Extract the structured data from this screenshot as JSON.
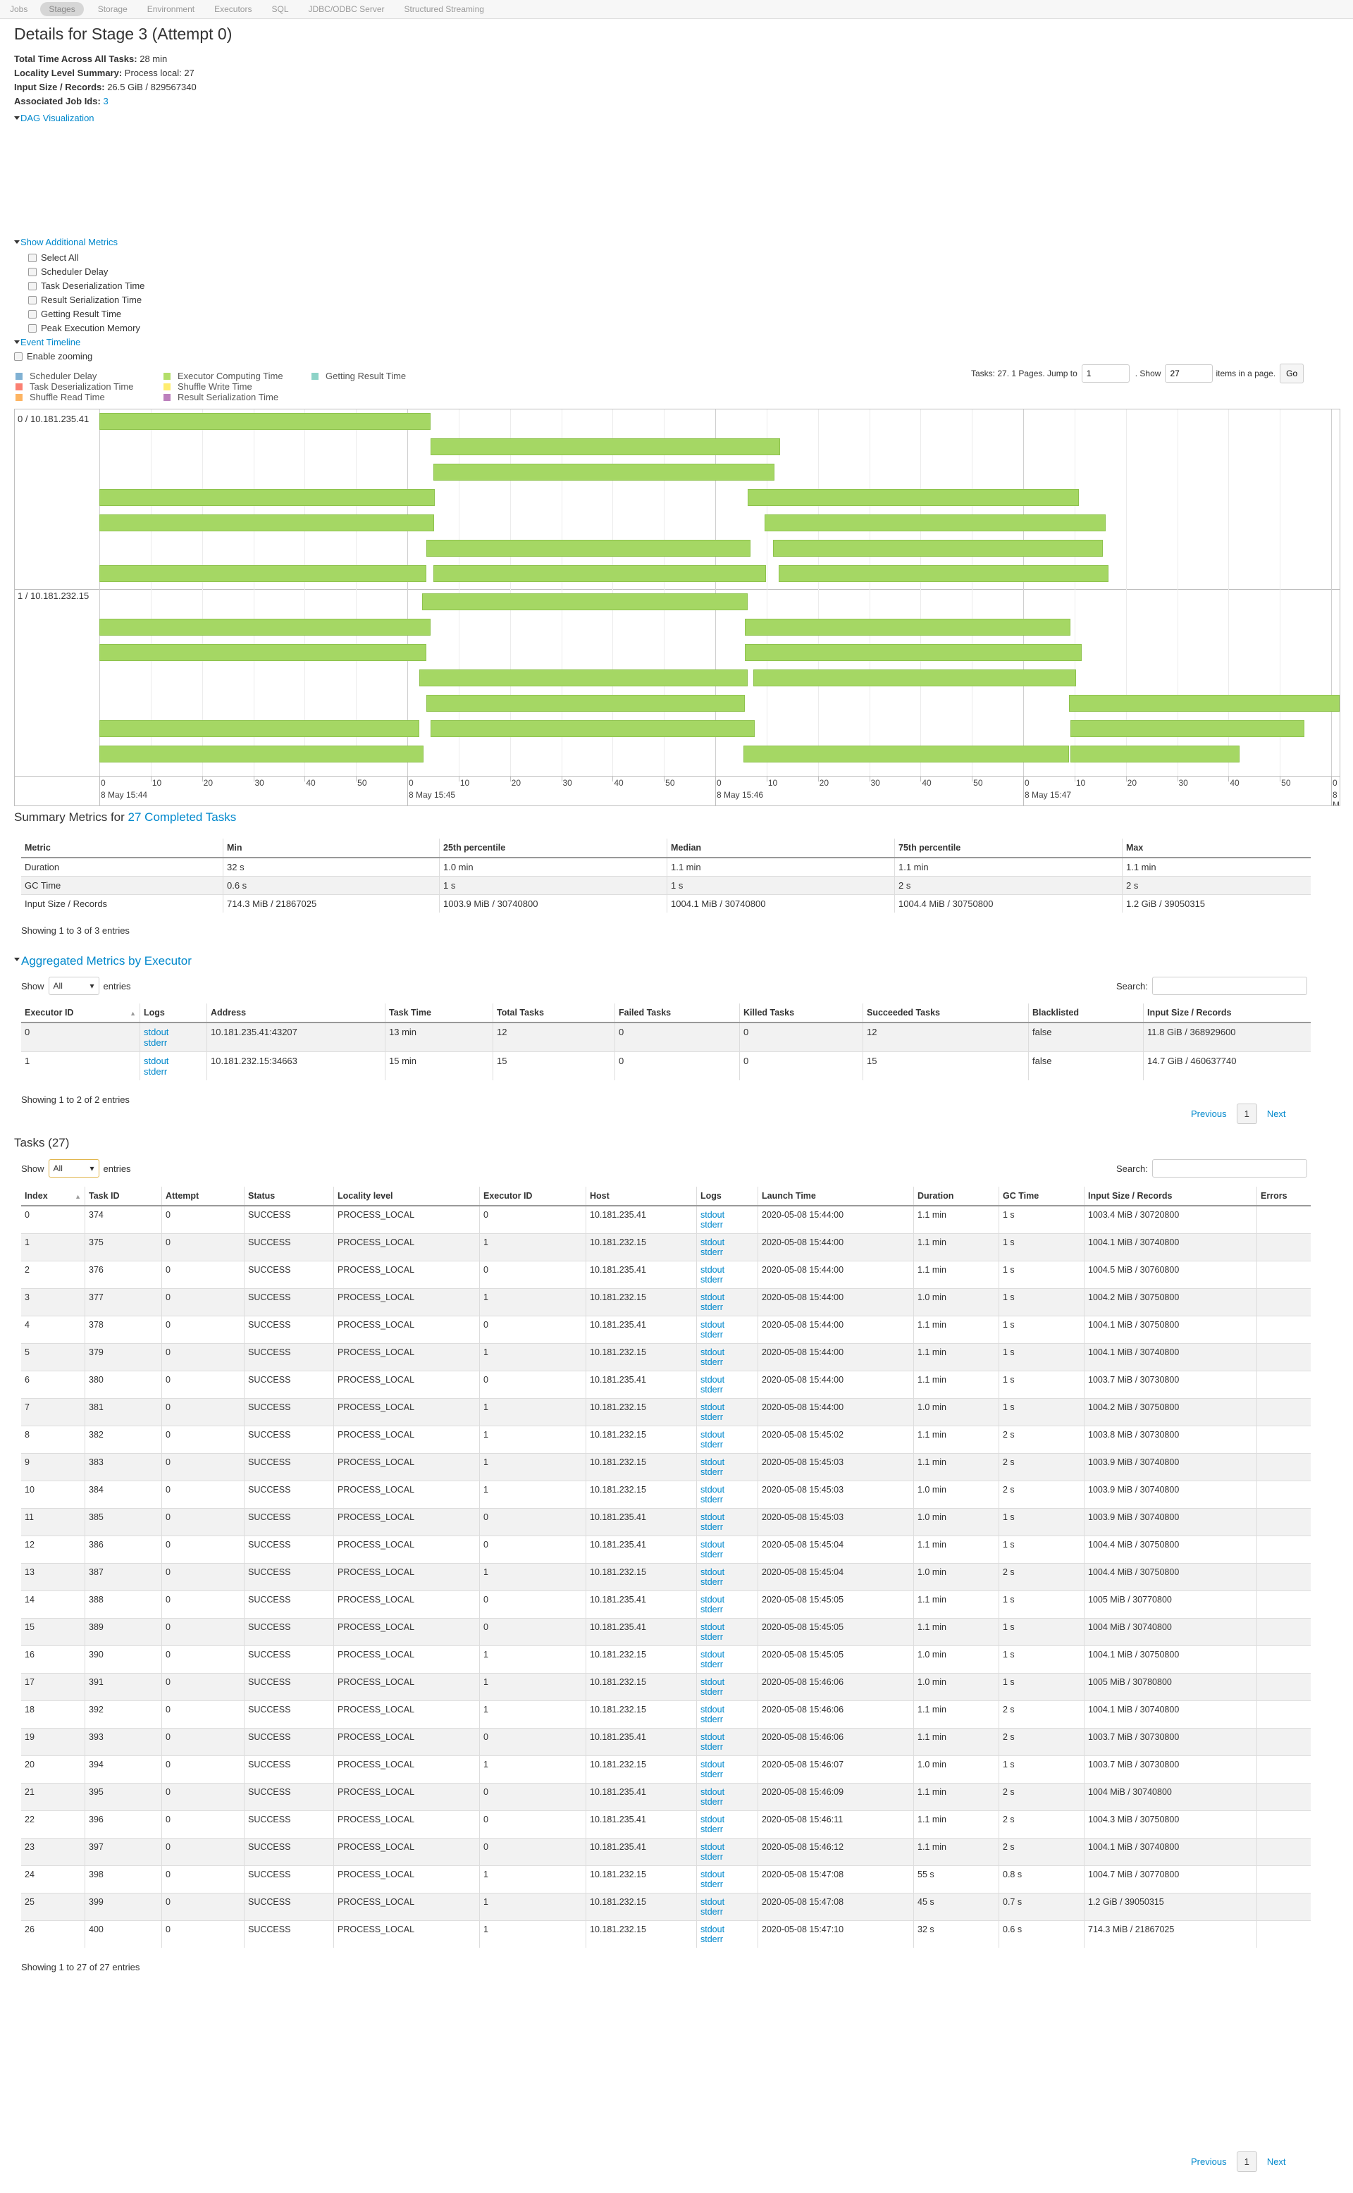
{
  "nav": {
    "items": [
      "Jobs",
      "Stages",
      "Storage",
      "Environment",
      "Executors",
      "SQL",
      "JDBC/ODBC Server",
      "Structured Streaming"
    ],
    "active": "Stages"
  },
  "header": {
    "title": "Details for Stage 3 (Attempt 0)"
  },
  "summary": {
    "total_time_label": "Total Time Across All Tasks:",
    "total_time": "28 min",
    "locality_label": "Locality Level Summary:",
    "locality": "Process local: 27",
    "input_label": "Input Size / Records:",
    "input": "26.5 GiB / 829567340",
    "jobs_label": "Associated Job Ids:",
    "jobs": "3"
  },
  "dag": {
    "label": "DAG Visualization"
  },
  "additional_metrics": {
    "label": "Show Additional Metrics",
    "options": [
      "Select All",
      "Scheduler Delay",
      "Task Deserialization Time",
      "Result Serialization Time",
      "Getting Result Time",
      "Peak Execution Memory"
    ]
  },
  "event_timeline": {
    "label": "Event Timeline",
    "zoom_label": "Enable zooming",
    "legend": [
      {
        "label": "Scheduler Delay",
        "color": "#80b1d3"
      },
      {
        "label": "Task Deserialization Time",
        "color": "#fb8072"
      },
      {
        "label": "Shuffle Read Time",
        "color": "#fdb462"
      },
      {
        "label": "Executor Computing Time",
        "color": "#b3de69"
      },
      {
        "label": "Shuffle Write Time",
        "color": "#ffed6f"
      },
      {
        "label": "Result Serialization Time",
        "color": "#bc80bd"
      },
      {
        "label": "Getting Result Time",
        "color": "#8dd3c7"
      }
    ],
    "controls": {
      "tasks_text": "Tasks: 27. 1 Pages. Jump to",
      "jump_value": "1",
      "show_label": ". Show",
      "show_value": "27",
      "items_label": "items in a page.",
      "go_label": "Go"
    },
    "executors": [
      "0 / 10.181.235.41",
      "1 / 10.181.232.15"
    ],
    "tick_labels": [
      "0",
      "10",
      "20",
      "30",
      "40",
      "50"
    ],
    "minute_labels": [
      "8 May 15:44",
      "8 May 15:45",
      "8 May 15:46",
      "8 May 15:47",
      "8 M"
    ]
  },
  "summary_metrics": {
    "title_prefix": "Summary Metrics for ",
    "title_link": "27 Completed Tasks",
    "headers": [
      "Metric",
      "Min",
      "25th percentile",
      "Median",
      "75th percentile",
      "Max"
    ],
    "rows": [
      [
        "Duration",
        "32 s",
        "1.0 min",
        "1.1 min",
        "1.1 min",
        "1.1 min"
      ],
      [
        "GC Time",
        "0.6 s",
        "1 s",
        "1 s",
        "2 s",
        "2 s"
      ],
      [
        "Input Size / Records",
        "714.3 MiB / 21867025",
        "1003.9 MiB / 30740800",
        "1004.1 MiB / 30740800",
        "1004.4 MiB / 30750800",
        "1.2 GiB / 39050315"
      ]
    ],
    "footer": "Showing 1 to 3 of 3 entries"
  },
  "executors_table": {
    "title": "Aggregated Metrics by Executor",
    "show_label": "Show",
    "entries_label": "entries",
    "show_value": "All",
    "search_label": "Search:",
    "headers": [
      "Executor ID",
      "Logs",
      "Address",
      "Task Time",
      "Total Tasks",
      "Failed Tasks",
      "Killed Tasks",
      "Succeeded Tasks",
      "Blacklisted",
      "Input Size / Records"
    ],
    "rows": [
      {
        "id": "0",
        "address": "10.181.235.41:43207",
        "task_time": "13 min",
        "total": "12",
        "failed": "0",
        "killed": "0",
        "succeeded": "12",
        "blacklisted": "false",
        "input": "11.8 GiB / 368929600"
      },
      {
        "id": "1",
        "address": "10.181.232.15:34663",
        "task_time": "15 min",
        "total": "15",
        "failed": "0",
        "killed": "0",
        "succeeded": "15",
        "blacklisted": "false",
        "input": "14.7 GiB / 460637740"
      }
    ],
    "log_links": [
      "stdout",
      "stderr"
    ],
    "footer": "Showing 1 to 2 of 2 entries",
    "previous": "Previous",
    "page": "1",
    "next": "Next"
  },
  "tasks": {
    "title": "Tasks (27)",
    "show_label": "Show",
    "entries_label": "entries",
    "show_value": "All",
    "search_label": "Search:",
    "headers": [
      "Index",
      "Task ID",
      "Attempt",
      "Status",
      "Locality level",
      "Executor ID",
      "Host",
      "Logs",
      "Launch Time",
      "Duration",
      "GC Time",
      "Input Size / Records",
      "Errors"
    ],
    "rows": [
      [
        "0",
        "374",
        "0",
        "SUCCESS",
        "PROCESS_LOCAL",
        "0",
        "10.181.235.41",
        "2020-05-08 15:44:00",
        "1.1 min",
        "1 s",
        "1003.4 MiB / 30720800"
      ],
      [
        "1",
        "375",
        "0",
        "SUCCESS",
        "PROCESS_LOCAL",
        "1",
        "10.181.232.15",
        "2020-05-08 15:44:00",
        "1.1 min",
        "1 s",
        "1004.1 MiB / 30740800"
      ],
      [
        "2",
        "376",
        "0",
        "SUCCESS",
        "PROCESS_LOCAL",
        "0",
        "10.181.235.41",
        "2020-05-08 15:44:00",
        "1.1 min",
        "1 s",
        "1004.5 MiB / 30760800"
      ],
      [
        "3",
        "377",
        "0",
        "SUCCESS",
        "PROCESS_LOCAL",
        "1",
        "10.181.232.15",
        "2020-05-08 15:44:00",
        "1.0 min",
        "1 s",
        "1004.2 MiB / 30750800"
      ],
      [
        "4",
        "378",
        "0",
        "SUCCESS",
        "PROCESS_LOCAL",
        "0",
        "10.181.235.41",
        "2020-05-08 15:44:00",
        "1.1 min",
        "1 s",
        "1004.1 MiB / 30750800"
      ],
      [
        "5",
        "379",
        "0",
        "SUCCESS",
        "PROCESS_LOCAL",
        "1",
        "10.181.232.15",
        "2020-05-08 15:44:00",
        "1.1 min",
        "1 s",
        "1004.1 MiB / 30740800"
      ],
      [
        "6",
        "380",
        "0",
        "SUCCESS",
        "PROCESS_LOCAL",
        "0",
        "10.181.235.41",
        "2020-05-08 15:44:00",
        "1.1 min",
        "1 s",
        "1003.7 MiB / 30730800"
      ],
      [
        "7",
        "381",
        "0",
        "SUCCESS",
        "PROCESS_LOCAL",
        "1",
        "10.181.232.15",
        "2020-05-08 15:44:00",
        "1.0 min",
        "1 s",
        "1004.2 MiB / 30750800"
      ],
      [
        "8",
        "382",
        "0",
        "SUCCESS",
        "PROCESS_LOCAL",
        "1",
        "10.181.232.15",
        "2020-05-08 15:45:02",
        "1.1 min",
        "2 s",
        "1003.8 MiB / 30730800"
      ],
      [
        "9",
        "383",
        "0",
        "SUCCESS",
        "PROCESS_LOCAL",
        "1",
        "10.181.232.15",
        "2020-05-08 15:45:03",
        "1.1 min",
        "2 s",
        "1003.9 MiB / 30740800"
      ],
      [
        "10",
        "384",
        "0",
        "SUCCESS",
        "PROCESS_LOCAL",
        "1",
        "10.181.232.15",
        "2020-05-08 15:45:03",
        "1.0 min",
        "2 s",
        "1003.9 MiB / 30740800"
      ],
      [
        "11",
        "385",
        "0",
        "SUCCESS",
        "PROCESS_LOCAL",
        "0",
        "10.181.235.41",
        "2020-05-08 15:45:03",
        "1.0 min",
        "1 s",
        "1003.9 MiB / 30740800"
      ],
      [
        "12",
        "386",
        "0",
        "SUCCESS",
        "PROCESS_LOCAL",
        "0",
        "10.181.235.41",
        "2020-05-08 15:45:04",
        "1.1 min",
        "1 s",
        "1004.4 MiB / 30750800"
      ],
      [
        "13",
        "387",
        "0",
        "SUCCESS",
        "PROCESS_LOCAL",
        "1",
        "10.181.232.15",
        "2020-05-08 15:45:04",
        "1.0 min",
        "2 s",
        "1004.4 MiB / 30750800"
      ],
      [
        "14",
        "388",
        "0",
        "SUCCESS",
        "PROCESS_LOCAL",
        "0",
        "10.181.235.41",
        "2020-05-08 15:45:05",
        "1.1 min",
        "1 s",
        "1005 MiB / 30770800"
      ],
      [
        "15",
        "389",
        "0",
        "SUCCESS",
        "PROCESS_LOCAL",
        "0",
        "10.181.235.41",
        "2020-05-08 15:45:05",
        "1.1 min",
        "1 s",
        "1004 MiB / 30740800"
      ],
      [
        "16",
        "390",
        "0",
        "SUCCESS",
        "PROCESS_LOCAL",
        "1",
        "10.181.232.15",
        "2020-05-08 15:45:05",
        "1.0 min",
        "1 s",
        "1004.1 MiB / 30750800"
      ],
      [
        "17",
        "391",
        "0",
        "SUCCESS",
        "PROCESS_LOCAL",
        "1",
        "10.181.232.15",
        "2020-05-08 15:46:06",
        "1.0 min",
        "1 s",
        "1005 MiB / 30780800"
      ],
      [
        "18",
        "392",
        "0",
        "SUCCESS",
        "PROCESS_LOCAL",
        "1",
        "10.181.232.15",
        "2020-05-08 15:46:06",
        "1.1 min",
        "2 s",
        "1004.1 MiB / 30740800"
      ],
      [
        "19",
        "393",
        "0",
        "SUCCESS",
        "PROCESS_LOCAL",
        "0",
        "10.181.235.41",
        "2020-05-08 15:46:06",
        "1.1 min",
        "2 s",
        "1003.7 MiB / 30730800"
      ],
      [
        "20",
        "394",
        "0",
        "SUCCESS",
        "PROCESS_LOCAL",
        "1",
        "10.181.232.15",
        "2020-05-08 15:46:07",
        "1.0 min",
        "1 s",
        "1003.7 MiB / 30730800"
      ],
      [
        "21",
        "395",
        "0",
        "SUCCESS",
        "PROCESS_LOCAL",
        "0",
        "10.181.235.41",
        "2020-05-08 15:46:09",
        "1.1 min",
        "2 s",
        "1004 MiB / 30740800"
      ],
      [
        "22",
        "396",
        "0",
        "SUCCESS",
        "PROCESS_LOCAL",
        "0",
        "10.181.235.41",
        "2020-05-08 15:46:11",
        "1.1 min",
        "2 s",
        "1004.3 MiB / 30750800"
      ],
      [
        "23",
        "397",
        "0",
        "SUCCESS",
        "PROCESS_LOCAL",
        "0",
        "10.181.235.41",
        "2020-05-08 15:46:12",
        "1.1 min",
        "2 s",
        "1004.1 MiB / 30740800"
      ],
      [
        "24",
        "398",
        "0",
        "SUCCESS",
        "PROCESS_LOCAL",
        "1",
        "10.181.232.15",
        "2020-05-08 15:47:08",
        "55 s",
        "0.8 s",
        "1004.7 MiB / 30770800"
      ],
      [
        "25",
        "399",
        "0",
        "SUCCESS",
        "PROCESS_LOCAL",
        "1",
        "10.181.232.15",
        "2020-05-08 15:47:08",
        "45 s",
        "0.7 s",
        "1.2 GiB / 39050315"
      ],
      [
        "26",
        "400",
        "0",
        "SUCCESS",
        "PROCESS_LOCAL",
        "1",
        "10.181.232.15",
        "2020-05-08 15:47:10",
        "32 s",
        "0.6 s",
        "714.3 MiB / 21867025"
      ]
    ],
    "log_links": [
      "stdout",
      "stderr"
    ],
    "footer": "Showing 1 to 27 of 27 entries",
    "previous": "Previous",
    "page": "1",
    "next": "Next"
  },
  "colors": {
    "link": "#0088cc",
    "bar": "#a5d764",
    "row_alt": "#f2f2f2"
  }
}
